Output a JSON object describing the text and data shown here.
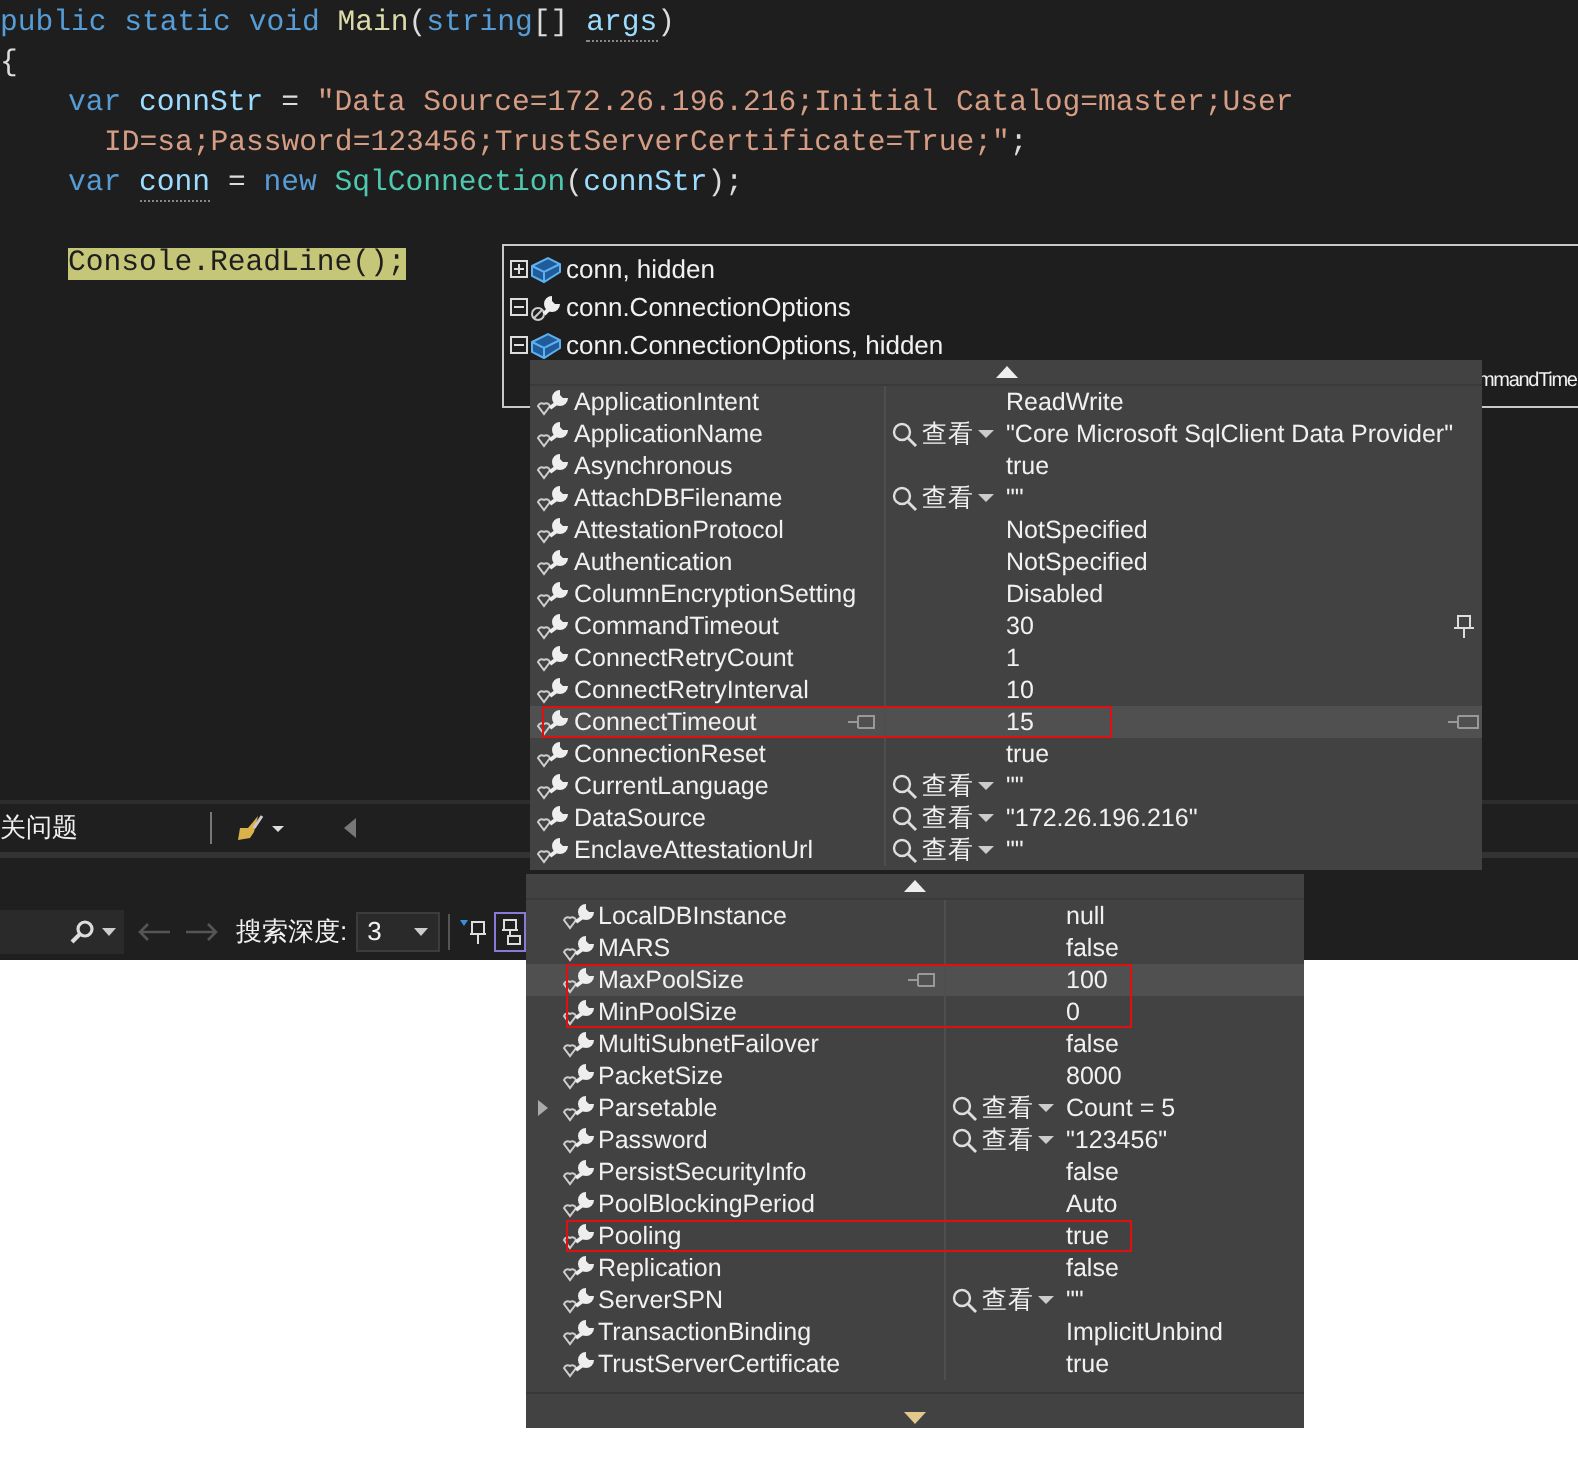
{
  "editor": {
    "lines": [
      {
        "kind": "top",
        "tokens": [
          {
            "kind": "keyword",
            "text": "public static void "
          },
          {
            "kind": "method",
            "text": "Main"
          },
          {
            "kind": "plain",
            "text": "("
          },
          {
            "kind": "keyword",
            "text": "string"
          },
          {
            "kind": "plain",
            "text": "[] "
          },
          {
            "kind": "unused",
            "text": "args"
          },
          {
            "kind": "plain",
            "text": ")"
          }
        ]
      },
      {
        "kind": "top",
        "tokens": [
          {
            "kind": "plain",
            "text": "{"
          }
        ]
      },
      {
        "kind": "body",
        "tokens": [
          {
            "kind": "keyword",
            "text": "var "
          },
          {
            "kind": "variable",
            "text": "connStr"
          },
          {
            "kind": "plain",
            "text": " = "
          },
          {
            "kind": "string",
            "text": "\"Data Source=172.26.196.216;Initial Catalog=master;User"
          }
        ]
      },
      {
        "kind": "wrap",
        "tokens": [
          {
            "kind": "string",
            "text": "ID=sa;Password=123456;TrustServerCertificate=True;\""
          },
          {
            "kind": "plain",
            "text": ";"
          }
        ]
      },
      {
        "kind": "body",
        "tokens": [
          {
            "kind": "keyword",
            "text": "var "
          },
          {
            "kind": "unused",
            "text": "conn"
          },
          {
            "kind": "plain",
            "text": " = "
          },
          {
            "kind": "keyword",
            "text": "new "
          },
          {
            "kind": "type",
            "text": "SqlConnection"
          },
          {
            "kind": "plain",
            "text": "("
          },
          {
            "kind": "variable",
            "text": "connStr"
          },
          {
            "kind": "plain",
            "text": ");"
          }
        ]
      },
      {
        "kind": "blank"
      },
      {
        "kind": "body",
        "tokens": [
          {
            "kind": "current",
            "text": "Console.ReadLine();"
          }
        ]
      }
    ]
  },
  "datatip": {
    "rows": [
      {
        "kind": "object",
        "text": "conn, hidden",
        "expanded": false
      },
      {
        "kind": "property",
        "text": "conn.ConnectionOptions",
        "expanded": true
      },
      {
        "kind": "object",
        "text": "conn.ConnectionOptions, hidden",
        "expanded": true
      }
    ],
    "overflow_text": "mmandTime"
  },
  "output_bar": {
    "label": "关问题"
  },
  "search_bar": {
    "depth_label": "搜索深度:",
    "depth": "3"
  },
  "popups": [
    {
      "rows": [
        {
          "name": "ApplicationIntent",
          "value": "ReadWrite",
          "hovered": false,
          "marked": false,
          "pinned": false
        },
        {
          "name": "ApplicationName",
          "visualizer": "查看",
          "value": "\"Core Microsoft SqlClient Data Provider\"",
          "hovered": false,
          "marked": false,
          "pinned": false
        },
        {
          "name": "Asynchronous",
          "value": "true",
          "hovered": false,
          "marked": false,
          "pinned": false
        },
        {
          "name": "AttachDBFilename",
          "visualizer": "查看",
          "value": "\"\"",
          "hovered": false,
          "marked": false,
          "pinned": false
        },
        {
          "name": "AttestationProtocol",
          "value": "NotSpecified",
          "hovered": false,
          "marked": false,
          "pinned": false
        },
        {
          "name": "Authentication",
          "value": "NotSpecified",
          "hovered": false,
          "marked": false,
          "pinned": false
        },
        {
          "name": "ColumnEncryptionSetting",
          "value": "Disabled",
          "hovered": false,
          "marked": false,
          "pinned": false
        },
        {
          "name": "CommandTimeout",
          "value": "30",
          "hovered": false,
          "marked": false,
          "pinned": true
        },
        {
          "name": "ConnectRetryCount",
          "value": "1",
          "hovered": false,
          "marked": false,
          "pinned": false
        },
        {
          "name": "ConnectRetryInterval",
          "value": "10",
          "hovered": false,
          "marked": false,
          "pinned": false
        },
        {
          "name": "ConnectTimeout",
          "value": "15",
          "hovered": true,
          "marked": true,
          "pinned": false
        },
        {
          "name": "ConnectionReset",
          "value": "true",
          "hovered": false,
          "marked": false,
          "pinned": false
        },
        {
          "name": "CurrentLanguage",
          "visualizer": "查看",
          "value": "\"\"",
          "hovered": false,
          "marked": false,
          "pinned": false
        },
        {
          "name": "DataSource",
          "visualizer": "查看",
          "value": "\"172.26.196.216\"",
          "hovered": false,
          "marked": false,
          "pinned": false
        },
        {
          "name": "EnclaveAttestationUrl",
          "visualizer": "查看",
          "value": "\"\"",
          "hovered": false,
          "marked": false,
          "pinned": false
        }
      ]
    },
    {
      "rows": [
        {
          "kind": "plain",
          "name": "LocalDBInstance",
          "value": "null",
          "hovered": false,
          "marked": false
        },
        {
          "kind": "plain",
          "name": "MARS",
          "value": "false",
          "hovered": false,
          "marked": false
        },
        {
          "kind": "plain",
          "name": "MaxPoolSize",
          "value": "100",
          "hovered": true,
          "marked": true
        },
        {
          "kind": "plain",
          "name": "MinPoolSize",
          "value": "0",
          "hovered": false,
          "marked": true
        },
        {
          "kind": "plain",
          "name": "MultiSubnetFailover",
          "value": "false",
          "hovered": false,
          "marked": false
        },
        {
          "kind": "plain",
          "name": "PacketSize",
          "value": "8000",
          "hovered": false,
          "marked": false
        },
        {
          "kind": "expandable",
          "name": "Parsetable",
          "visualizer": "查看",
          "value": "Count = 5",
          "hovered": false,
          "marked": false
        },
        {
          "kind": "plain",
          "name": "Password",
          "visualizer": "查看",
          "value": "\"123456\"",
          "hovered": false,
          "marked": false
        },
        {
          "kind": "plain",
          "name": "PersistSecurityInfo",
          "value": "false",
          "hovered": false,
          "marked": false
        },
        {
          "kind": "plain",
          "name": "PoolBlockingPeriod",
          "value": "Auto",
          "hovered": false,
          "marked": false
        },
        {
          "kind": "plain",
          "name": "Pooling",
          "value": "true",
          "hovered": false,
          "marked": true
        },
        {
          "kind": "plain",
          "name": "Replication",
          "value": "false",
          "hovered": false,
          "marked": false
        },
        {
          "kind": "plain",
          "name": "ServerSPN",
          "visualizer": "查看",
          "value": "\"\"",
          "hovered": false,
          "marked": false
        },
        {
          "kind": "plain",
          "name": "TransactionBinding",
          "value": "ImplicitUnbind",
          "hovered": false,
          "marked": false
        },
        {
          "kind": "plain",
          "name": "TrustServerCertificate",
          "value": "true",
          "hovered": false,
          "marked": false
        }
      ]
    }
  ]
}
